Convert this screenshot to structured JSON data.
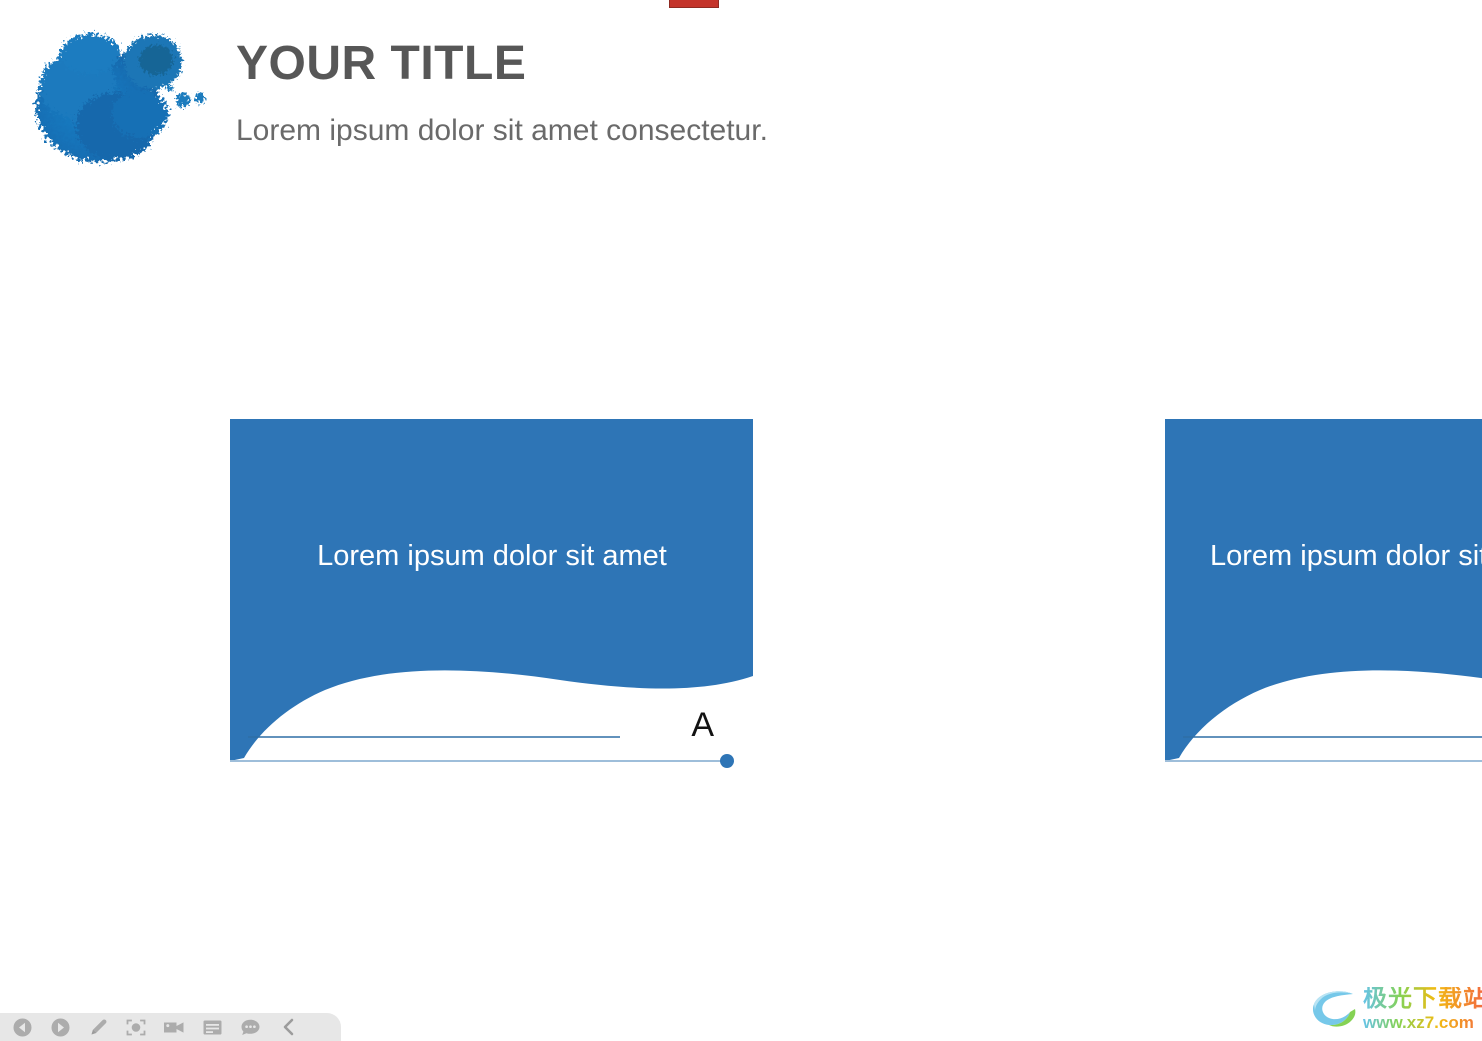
{
  "slide": {
    "background_color": "#FFFFFF",
    "accent_color": "#2E75B6",
    "title": "YOUR TITLE",
    "subtitle": "Lorem ipsum dolor sit amet consectetur.",
    "title_color": "#575757",
    "logo_name": "blue-watercolor-splatter",
    "top_marker_color": "#C4342B"
  },
  "cards": [
    {
      "label": "Lorem ipsum dolor sit amet",
      "letter": "A",
      "fill_color": "#2E75B6",
      "label_color": "#FFFFFF"
    },
    {
      "label": "Lorem ipsum dolor sit amet",
      "letter": "",
      "fill_color": "#2E75B6",
      "label_color": "#FFFFFF"
    }
  ],
  "toolbar": {
    "background_color": "#E7E7E7",
    "icon_color": "#ACACAC",
    "buttons": [
      {
        "name": "previous-slide-button",
        "icon": "previous-icon",
        "label": "Previous"
      },
      {
        "name": "next-slide-button",
        "icon": "next-icon",
        "label": "Next"
      },
      {
        "name": "pen-tool-button",
        "icon": "pen-icon",
        "label": "Pen"
      },
      {
        "name": "spotlight-button",
        "icon": "spotlight-icon",
        "label": "Spotlight"
      },
      {
        "name": "video-button",
        "icon": "video-camera-icon",
        "label": "Video"
      },
      {
        "name": "notes-button",
        "icon": "notes-icon",
        "label": "Notes"
      },
      {
        "name": "more-options-button",
        "icon": "ellipsis-icon",
        "label": "More"
      },
      {
        "name": "collapse-toolbar-button",
        "icon": "chevron-left-icon",
        "label": "Collapse"
      }
    ]
  },
  "watermark": {
    "cn_text": "极光下载站",
    "url_text": "www.xz7.com"
  }
}
